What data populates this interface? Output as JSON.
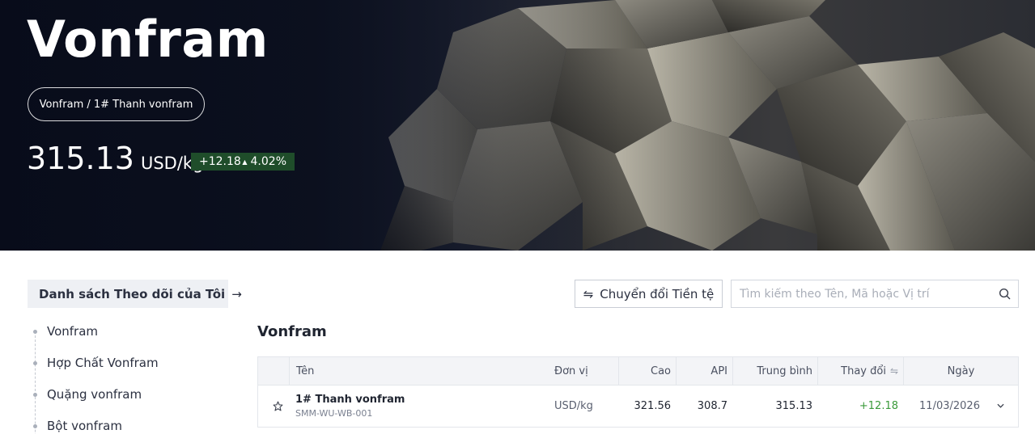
{
  "hero": {
    "title": "Vonfram",
    "breadcrumb": "Vonfram / 1# Thanh vonfram",
    "price": "315.13",
    "unit": "USD/kg",
    "change": "+12.18",
    "change_pct": "4.02%",
    "change_icon": "triangle-up-icon",
    "badge_color": "#1f4d2a"
  },
  "sidebar": {
    "watchlist_label": "Danh sách Theo dõi của Tôi",
    "watchlist_arrow": "→",
    "items": [
      {
        "label": "Vonfram"
      },
      {
        "label": "Hợp Chất Vonfram"
      },
      {
        "label": "Quặng vonfram"
      },
      {
        "label": "Bột vonfram"
      }
    ]
  },
  "toolbar": {
    "currency_icon": "⇋",
    "currency_label": "Chuyển đổi Tiền tệ",
    "search_placeholder": "Tìm kiếm theo Tên, Mã hoặc Vị trí"
  },
  "main": {
    "section_title": "Vonfram",
    "columns": {
      "name": "Tên",
      "unit": "Đơn vị",
      "high": "Cao",
      "api": "API",
      "avg": "Trung bình",
      "change": "Thay đổi",
      "date": "Ngày"
    },
    "rows": [
      {
        "name": "1# Thanh vonfram",
        "code": "SMM-WU-WB-001",
        "unit": "USD/kg",
        "high": "321.56",
        "api": "308.7",
        "avg": "315.13",
        "change": "+12.18",
        "date": "11/03/2026"
      }
    ]
  },
  "colors": {
    "positive": "#3a9a3a",
    "accent_dark": "#0d1222"
  }
}
